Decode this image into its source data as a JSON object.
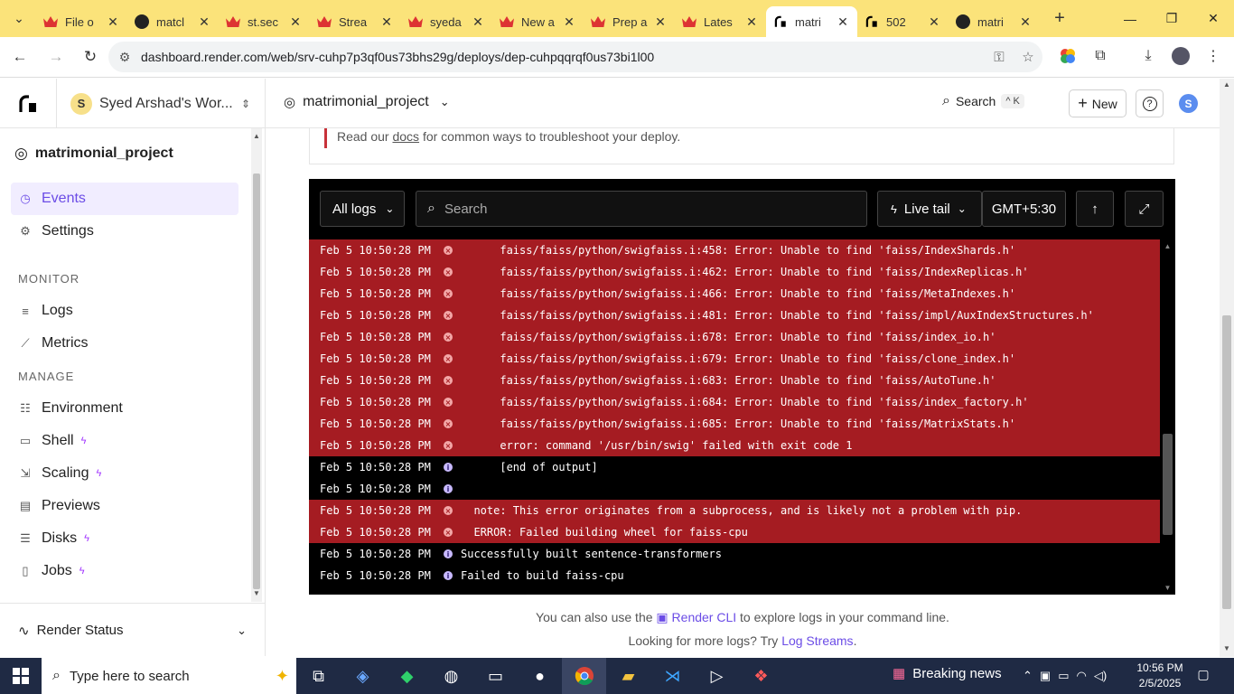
{
  "browser": {
    "tabs": [
      {
        "title": "File o",
        "icon": "red-crown"
      },
      {
        "title": "matcl",
        "icon": "github-cat"
      },
      {
        "title": "st.sec",
        "icon": "red-crown"
      },
      {
        "title": "Strea",
        "icon": "red-crown"
      },
      {
        "title": "syeda",
        "icon": "red-crown"
      },
      {
        "title": "New a",
        "icon": "red-crown"
      },
      {
        "title": "Prep a",
        "icon": "red-crown"
      },
      {
        "title": "Lates",
        "icon": "red-crown"
      },
      {
        "title": "matri",
        "icon": "render",
        "active": true
      },
      {
        "title": "502",
        "icon": "render"
      },
      {
        "title": "matri",
        "icon": "github-cat"
      }
    ],
    "url": "dashboard.render.com/web/srv-cuhp7p3qf0us73bhs29g/deploys/dep-cuhpqqrqf0us73bi1l00"
  },
  "header": {
    "workspace_initial": "S",
    "workspace_name": "Syed Arshad's Wor...",
    "project_name": "matrimonial_project",
    "search_label": "Search",
    "search_shortcut": "^ K",
    "new_label": "New",
    "help_icon": "?",
    "user_initial": "S"
  },
  "sidebar": {
    "service_name": "matrimonial_project",
    "items": [
      {
        "label": "Events",
        "icon": "events-icon"
      },
      {
        "label": "Settings",
        "icon": "gear-icon"
      }
    ],
    "monitor_label": "MONITOR",
    "monitor_items": [
      {
        "label": "Logs",
        "icon": "logs-icon"
      },
      {
        "label": "Metrics",
        "icon": "metrics-icon"
      }
    ],
    "manage_label": "MANAGE",
    "manage_items": [
      {
        "label": "Environment",
        "icon": "environment-icon"
      },
      {
        "label": "Shell",
        "icon": "shell-icon"
      },
      {
        "label": "Scaling",
        "icon": "scaling-icon"
      },
      {
        "label": "Previews",
        "icon": "previews-icon"
      },
      {
        "label": "Disks",
        "icon": "disks-icon"
      },
      {
        "label": "Jobs",
        "icon": "jobs-icon"
      }
    ],
    "render_status": "Render Status"
  },
  "notice": {
    "pre": "Read our ",
    "link": "docs",
    "post": " for common ways to troubleshoot your deploy."
  },
  "logs": {
    "filter": "All logs",
    "search_placeholder": "Search",
    "live_tail": "Live tail",
    "timezone": "GMT+5:30",
    "rows": [
      {
        "ts": "Feb 5 10:50:28 PM",
        "level": "error",
        "msg": "      faiss/faiss/python/swigfaiss.i:458: Error: Unable to find 'faiss/IndexShards.h'"
      },
      {
        "ts": "Feb 5 10:50:28 PM",
        "level": "error",
        "msg": "      faiss/faiss/python/swigfaiss.i:462: Error: Unable to find 'faiss/IndexReplicas.h'"
      },
      {
        "ts": "Feb 5 10:50:28 PM",
        "level": "error",
        "msg": "      faiss/faiss/python/swigfaiss.i:466: Error: Unable to find 'faiss/MetaIndexes.h'"
      },
      {
        "ts": "Feb 5 10:50:28 PM",
        "level": "error",
        "msg": "      faiss/faiss/python/swigfaiss.i:481: Error: Unable to find 'faiss/impl/AuxIndexStructures.h'"
      },
      {
        "ts": "Feb 5 10:50:28 PM",
        "level": "error",
        "msg": "      faiss/faiss/python/swigfaiss.i:678: Error: Unable to find 'faiss/index_io.h'"
      },
      {
        "ts": "Feb 5 10:50:28 PM",
        "level": "error",
        "msg": "      faiss/faiss/python/swigfaiss.i:679: Error: Unable to find 'faiss/clone_index.h'"
      },
      {
        "ts": "Feb 5 10:50:28 PM",
        "level": "error",
        "msg": "      faiss/faiss/python/swigfaiss.i:683: Error: Unable to find 'faiss/AutoTune.h'"
      },
      {
        "ts": "Feb 5 10:50:28 PM",
        "level": "error",
        "msg": "      faiss/faiss/python/swigfaiss.i:684: Error: Unable to find 'faiss/index_factory.h'"
      },
      {
        "ts": "Feb 5 10:50:28 PM",
        "level": "error",
        "msg": "      faiss/faiss/python/swigfaiss.i:685: Error: Unable to find 'faiss/MatrixStats.h'"
      },
      {
        "ts": "Feb 5 10:50:28 PM",
        "level": "error",
        "msg": "      error: command '/usr/bin/swig' failed with exit code 1"
      },
      {
        "ts": "Feb 5 10:50:28 PM",
        "level": "info",
        "msg": "      [end of output]"
      },
      {
        "ts": "Feb 5 10:50:28 PM",
        "level": "info",
        "msg": ""
      },
      {
        "ts": "Feb 5 10:50:28 PM",
        "level": "error",
        "msg": "  note: This error originates from a subprocess, and is likely not a problem with pip."
      },
      {
        "ts": "Feb 5 10:50:28 PM",
        "level": "error",
        "msg": "  ERROR: Failed building wheel for faiss-cpu"
      },
      {
        "ts": "Feb 5 10:50:28 PM",
        "level": "info",
        "msg": "Successfully built sentence-transformers"
      },
      {
        "ts": "Feb 5 10:50:28 PM",
        "level": "info",
        "msg": "Failed to build faiss-cpu"
      }
    ]
  },
  "footer": {
    "line1_pre": "You can also use the ",
    "line1_link": "Render CLI",
    "line1_post": " to explore logs in your command line.",
    "line2_pre": "Looking for more logs? Try ",
    "line2_link": "Log Streams",
    "line2_post": "."
  },
  "taskbar": {
    "search_placeholder": "Type here to search",
    "news": "Breaking news",
    "time": "10:56 PM",
    "date": "2/5/2025"
  },
  "colors": {
    "error_row": "#a51c22",
    "accent": "#6b4ce6",
    "tabbar": "#fbe37a"
  }
}
